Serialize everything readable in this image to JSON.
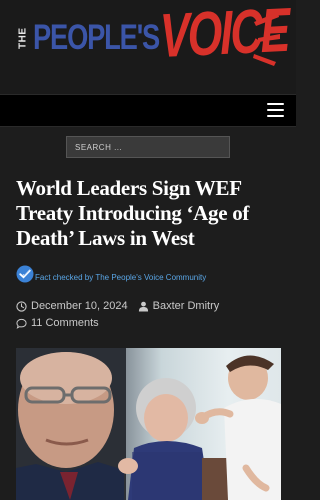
{
  "site": {
    "logo_the": "THE",
    "logo_people": "PEOPLE'S",
    "logo_voice": "VOICE",
    "colors": {
      "blue": "#3b55a8",
      "red": "#d8312a",
      "link": "#5aa6e6"
    }
  },
  "nav": {
    "menu_icon": "hamburger-icon"
  },
  "search": {
    "placeholder": "SEARCH ..."
  },
  "article": {
    "headline": "World Leaders Sign WEF Treaty Introducing ‘Age of Death’ Laws in West",
    "fact_check": "Fact checked by The People's Voice Community",
    "date": "December 10, 2024",
    "author": "Baxter Dmitry",
    "comments": "11 Comments"
  }
}
